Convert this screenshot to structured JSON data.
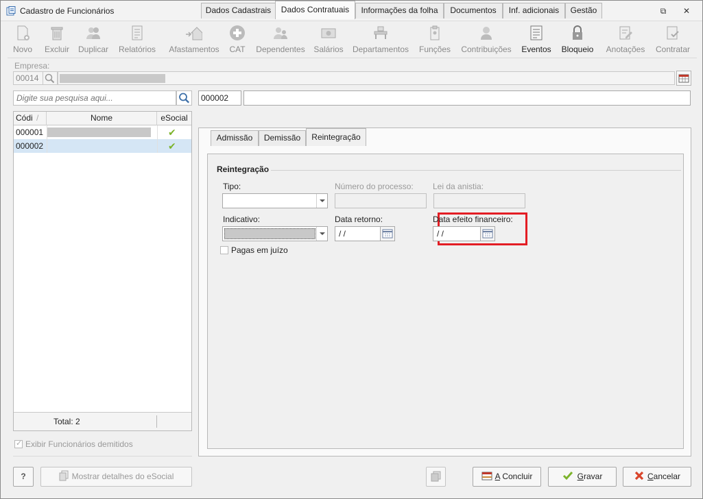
{
  "window": {
    "title": "Cadastro de Funcionários",
    "restore_symbol": "⧉",
    "close_symbol": "✕"
  },
  "toolbar": [
    {
      "label": "Novo",
      "icon": "new-document-icon",
      "enabled": false
    },
    {
      "label": "Excluir",
      "icon": "trash-icon",
      "enabled": false
    },
    {
      "label": "Duplicar",
      "icon": "duplicate-users-icon",
      "enabled": false
    },
    {
      "label": "Relatórios",
      "icon": "report-icon",
      "enabled": false
    },
    {
      "label": "Afastamentos",
      "icon": "house-leave-icon",
      "enabled": false
    },
    {
      "label": "CAT",
      "icon": "medical-cross-icon",
      "enabled": false
    },
    {
      "label": "Dependentes",
      "icon": "dependents-icon",
      "enabled": false
    },
    {
      "label": "Salários",
      "icon": "money-icon",
      "enabled": false
    },
    {
      "label": "Departamentos",
      "icon": "department-icon",
      "enabled": false
    },
    {
      "label": "Funções",
      "icon": "badge-icon",
      "enabled": false
    },
    {
      "label": "Contribuições",
      "icon": "contributions-icon",
      "enabled": false
    },
    {
      "label": "Eventos",
      "icon": "events-list-icon",
      "enabled": true
    },
    {
      "label": "Bloqueio",
      "icon": "lock-icon",
      "enabled": true
    },
    {
      "label": "Anotações",
      "icon": "notes-icon",
      "enabled": false
    },
    {
      "label": "Contratar",
      "icon": "contract-icon",
      "enabled": false
    }
  ],
  "empresa": {
    "label": "Empresa:",
    "code": "00014"
  },
  "search": {
    "placeholder": "Digite sua pesquisa aqui...",
    "code": "000002"
  },
  "grid": {
    "headers": [
      "Códi",
      "Nome",
      "eSocial"
    ],
    "sort_indicator": "/",
    "rows": [
      {
        "code": "000001",
        "esocial": "✔"
      },
      {
        "code": "000002",
        "esocial": "✔"
      }
    ],
    "total_label": "Total: 2"
  },
  "show_demitidos_label": "Exibir Funcionários demitidos",
  "tabs": [
    "Dados Cadastrais",
    "Dados Contratuais",
    "Informações da folha",
    "Documentos",
    "Inf. adicionais",
    "Gestão"
  ],
  "active_tab": "Dados Contratuais",
  "subtabs": [
    "Admissão",
    "Demissão",
    "Reintegração"
  ],
  "active_subtab": "Reintegração",
  "reintegracao": {
    "group_title": "Reintegração",
    "tipo_label": "Tipo:",
    "processo_label": "Número do processo:",
    "lei_label": "Lei da anistia:",
    "indicativo_label": "Indicativo:",
    "data_retorno_label": "Data retorno:",
    "data_retorno_value": "/ /",
    "data_efeito_label": "Data efeito financeiro:",
    "data_efeito_value": "/ /",
    "pagas_label": "Pagas em juízo"
  },
  "buttons": {
    "help": "?",
    "mostrar_esocial": "Mostrar detalhes do eSocial",
    "concluir_underline": "A",
    "concluir_rest": " Concluir",
    "gravar_underline": "G",
    "gravar_rest": "ravar",
    "cancelar_underline": "C",
    "cancelar_rest": "ancelar"
  },
  "colors": {
    "highlight": "#e31d24",
    "selected_row": "#d5e6f5",
    "check_green": "#7cb32b"
  }
}
